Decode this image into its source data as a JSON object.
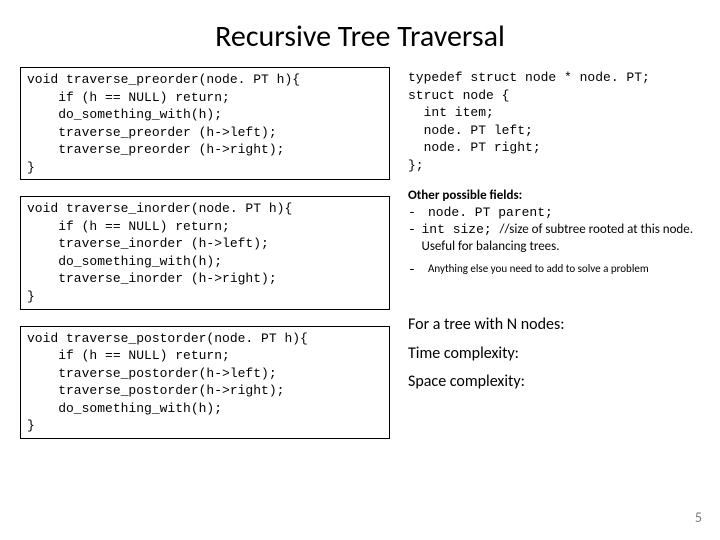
{
  "title": "Recursive Tree Traversal",
  "code": {
    "preorder": "void traverse_preorder(node. PT h){\n    if (h == NULL) return;\n    do_something_with(h);\n    traverse_preorder (h->left);\n    traverse_preorder (h->right);\n}",
    "inorder": "void traverse_inorder(node. PT h){\n    if (h == NULL) return;\n    traverse_inorder (h->left);\n    do_something_with(h);\n    traverse_inorder (h->right);\n}",
    "postorder": "void traverse_postorder(node. PT h){\n    if (h == NULL) return;\n    traverse_postorder(h->left);\n    traverse_postorder(h->right);\n    do_something_with(h);\n}",
    "typedef": "typedef struct node * node. PT;\nstruct node {\n  int item;\n  node. PT left;\n  node. PT right;\n};"
  },
  "other": {
    "header": "Other possible fields:",
    "parent": "node. PT parent;",
    "size_code": "int size; ",
    "size_comment": "//size of subtree rooted at this node. Useful for balancing trees.",
    "anything": "Anything else you need to add to solve a problem"
  },
  "complexity": {
    "intro": "For a tree with N nodes:",
    "time": "Time complexity:",
    "space": "Space complexity:"
  },
  "page_num": "5"
}
